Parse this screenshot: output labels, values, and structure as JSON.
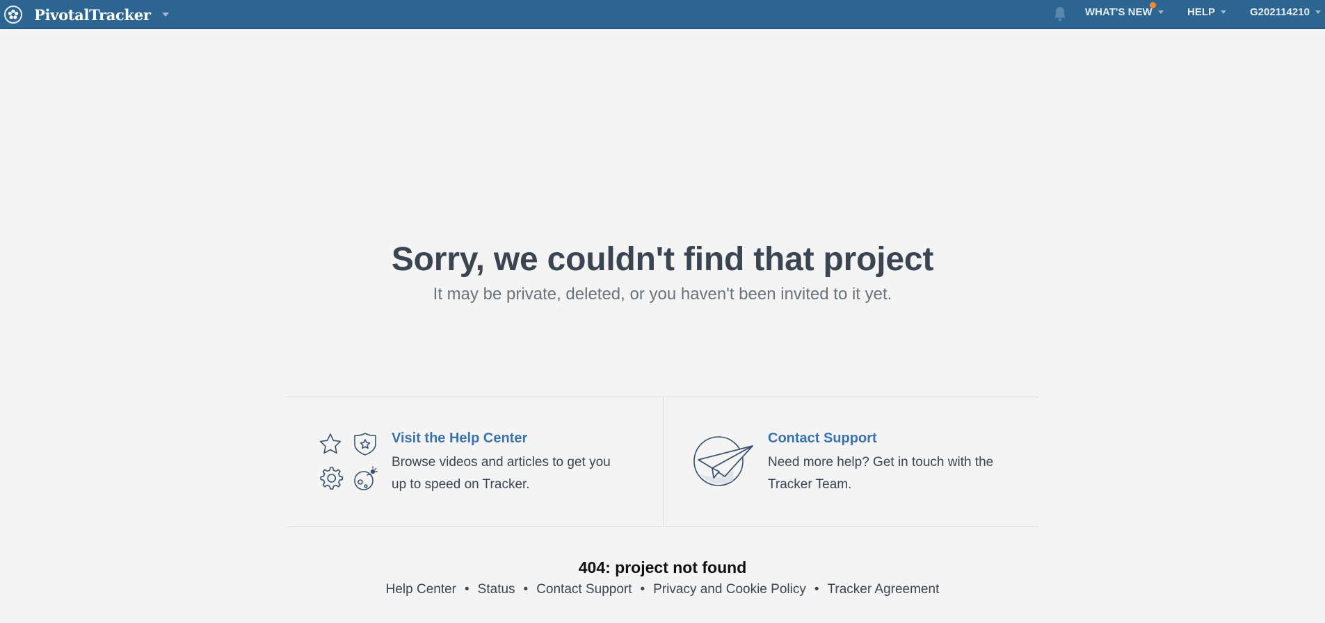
{
  "header": {
    "brand": "PivotalTracker",
    "nav": {
      "whats_new": "WHAT'S NEW",
      "help": "HELP",
      "user": "G202114210"
    }
  },
  "main": {
    "title": "Sorry, we couldn't find that project",
    "subtitle": "It may be private, deleted, or you haven't been invited to it yet."
  },
  "cards": [
    {
      "link": "Visit the Help Center",
      "desc_line1": "Browse videos and articles to get you",
      "desc_line2": "up to speed on Tracker."
    },
    {
      "link": "Contact Support",
      "desc_line1": "Need more help? Get in touch with the",
      "desc_line2": "Tracker Team."
    }
  ],
  "footer": {
    "error": "404: project not found",
    "links": [
      "Help Center",
      "Status",
      "Contact Support",
      "Privacy and Cookie Policy",
      "Tracker Agreement"
    ],
    "separator": "•"
  },
  "colors": {
    "topbar": "#2b6590",
    "background": "#f3f4f3",
    "link": "#3a72b0",
    "notification": "#f28b2c"
  }
}
